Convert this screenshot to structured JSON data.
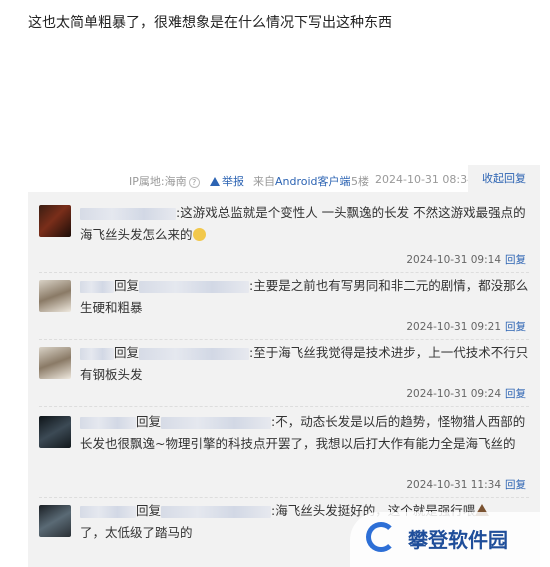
{
  "post": {
    "text": "这也太简单粗暴了，很难想象是在什么情况下写出这种东西"
  },
  "meta": {
    "ip_location": "IP属地:海南",
    "report": "举报",
    "client": "来自Android客户端",
    "floor": "5楼",
    "time": "2024-10-31 08:34",
    "reply_tab": "收起回复"
  },
  "comments": [
    {
      "text": ":这游戏总监就是个变性人 一头飘逸的长发 不然这游戏最强点的海飞丝头发怎么来的",
      "time": "2024-10-31 09:14",
      "reply": "回复"
    },
    {
      "reply_word": "回复",
      "text": ":主要是之前也有写男同和非二元的剧情，都没那么生硬和粗暴",
      "time": "2024-10-31 09:21",
      "reply": "回复"
    },
    {
      "reply_word": "回复",
      "text": ":至于海飞丝我觉得是技术进步，上一代技术不行只有钢板头发",
      "time": "2024-10-31 09:24",
      "reply": "回复"
    },
    {
      "reply_word": "回复",
      "text": ":不，动态长发是以后的趋势，怪物猎人西部的长发也很飘逸~物理引擎的科技点开罢了，我想以后打大作有能力全是海飞丝的",
      "time": "2024-10-31 11:34",
      "reply": "回复"
    },
    {
      "reply_word": "回复",
      "text": ":海飞丝头发挺好的，这个就是强行喂",
      "text2": "了，太低级了踏马的"
    }
  ],
  "watermark": {
    "text": "攀登软件园"
  },
  "colors": {
    "link": "#2d64b3",
    "panel": "#f2f2f2"
  }
}
